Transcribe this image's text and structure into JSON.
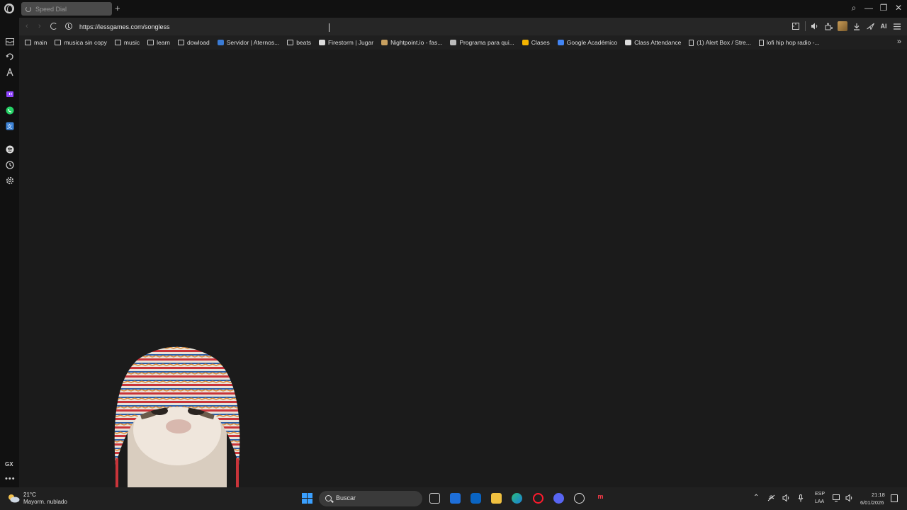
{
  "browser": {
    "tab": {
      "title": "Speed Dial"
    },
    "new_tab_symbol": "+",
    "window_controls": {
      "search": "⌕",
      "minimize": "—",
      "restore": "❐",
      "close": "✕"
    },
    "address": {
      "url": "https://lessgames.com/songless"
    },
    "extensions": {
      "ai_label": "AI"
    }
  },
  "sidebar": {
    "gx_label": "GX",
    "more_label": "•••",
    "icons": [
      "inbox-icon",
      "history-icon",
      "aria-icon",
      "twitch-icon",
      "whatsapp-icon",
      "translate-icon",
      "spotify-icon",
      "clock-icon",
      "settings-icon"
    ]
  },
  "bookmarks": [
    {
      "label": "main",
      "icon": "folder"
    },
    {
      "label": "musica sin copy",
      "icon": "folder"
    },
    {
      "label": "music",
      "icon": "folder"
    },
    {
      "label": "learn",
      "icon": "folder"
    },
    {
      "label": "dowload",
      "icon": "folder"
    },
    {
      "label": "Servidor | Aternos...",
      "icon": "aternos"
    },
    {
      "label": "beats",
      "icon": "folder"
    },
    {
      "label": "Firestorm | Jugar",
      "icon": "firestorm"
    },
    {
      "label": "Nightpoint.io - fas...",
      "icon": "nightpoint"
    },
    {
      "label": "Programa para qui...",
      "icon": "program"
    },
    {
      "label": "Clases",
      "icon": "classroom"
    },
    {
      "label": "Google Académico",
      "icon": "scholar"
    },
    {
      "label": "Class Attendance",
      "icon": "attendance"
    },
    {
      "label": "(1) Alert Box / Stre...",
      "icon": "page"
    },
    {
      "label": "lofi hip hop radio -...",
      "icon": "page"
    }
  ],
  "taskbar": {
    "weather": {
      "temp": "21°C",
      "desc": "Mayorm. nublado"
    },
    "search_placeholder": "Buscar",
    "lang_line1": "ESP",
    "lang_line2": "LAA",
    "time": "21:18",
    "date": "6/01/2026"
  },
  "colors": {
    "background": "#1b1b1b",
    "chrome": "#111111",
    "windows_blue": "#3aa0ff",
    "opera_red": "#ff1b2d"
  }
}
